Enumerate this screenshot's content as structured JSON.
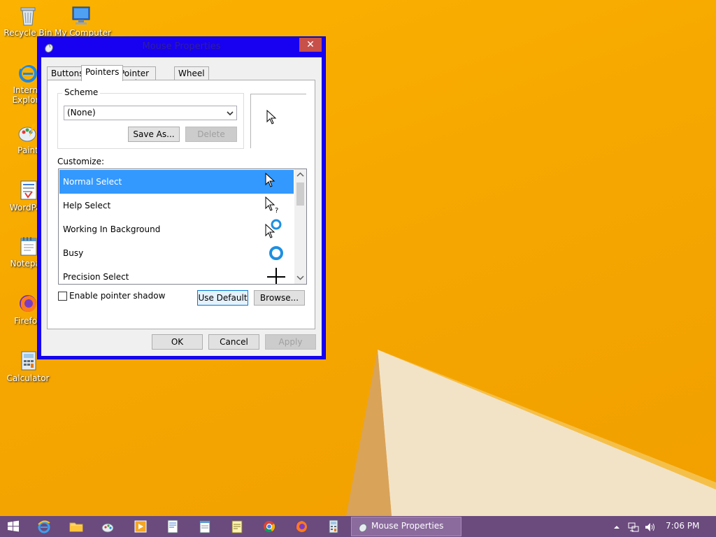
{
  "desktop": {
    "icons": [
      {
        "label": "Recycle Bin",
        "icon": "recycle-bin-icon"
      },
      {
        "label": "My Computer",
        "icon": "computer-icon"
      },
      {
        "label": "Internet Explorer",
        "line1": "Interne",
        "line2": "Explore",
        "icon": "internet-explorer-icon"
      },
      {
        "label": "Paint",
        "icon": "paint-icon"
      },
      {
        "label": "WordPad",
        "icon": "wordpad-icon"
      },
      {
        "label": "Notepad",
        "icon": "notepad-icon"
      },
      {
        "label": "Firefox",
        "icon": "firefox-icon"
      },
      {
        "label": "Calculator",
        "icon": "calculator-icon"
      }
    ]
  },
  "dialog": {
    "title": "Mouse Properties",
    "close_glyph": "✕",
    "tabs": [
      "Buttons",
      "Pointers",
      "Pointer Options",
      "Wheel"
    ],
    "active_tab": "Pointers",
    "scheme": {
      "label": "Scheme",
      "selected": "(None)",
      "save_as": "Save As...",
      "delete": "Delete"
    },
    "customize_label": "Customize:",
    "pointers": [
      {
        "name": "Normal Select",
        "icon": "arrow-cursor-icon",
        "selected": true
      },
      {
        "name": "Help Select",
        "icon": "help-cursor-icon",
        "selected": false
      },
      {
        "name": "Working In Background",
        "icon": "working-cursor-icon",
        "selected": false
      },
      {
        "name": "Busy",
        "icon": "busy-cursor-icon",
        "selected": false
      },
      {
        "name": "Precision Select",
        "icon": "crosshair-cursor-icon",
        "selected": false
      }
    ],
    "shadow_label": "Enable pointer shadow",
    "shadow_checked": false,
    "use_default": "Use Default",
    "browse": "Browse...",
    "ok": "OK",
    "cancel": "Cancel",
    "apply": "Apply"
  },
  "taskbar": {
    "pinned": [
      "start-icon",
      "internet-explorer-icon",
      "file-explorer-icon",
      "paint-icon",
      "media-player-icon",
      "wordpad-icon",
      "notepad-icon",
      "notes-icon",
      "chrome-icon",
      "firefox-icon",
      "calculator-icon"
    ],
    "task_label": "Mouse Properties",
    "clock": "7:06 PM"
  }
}
